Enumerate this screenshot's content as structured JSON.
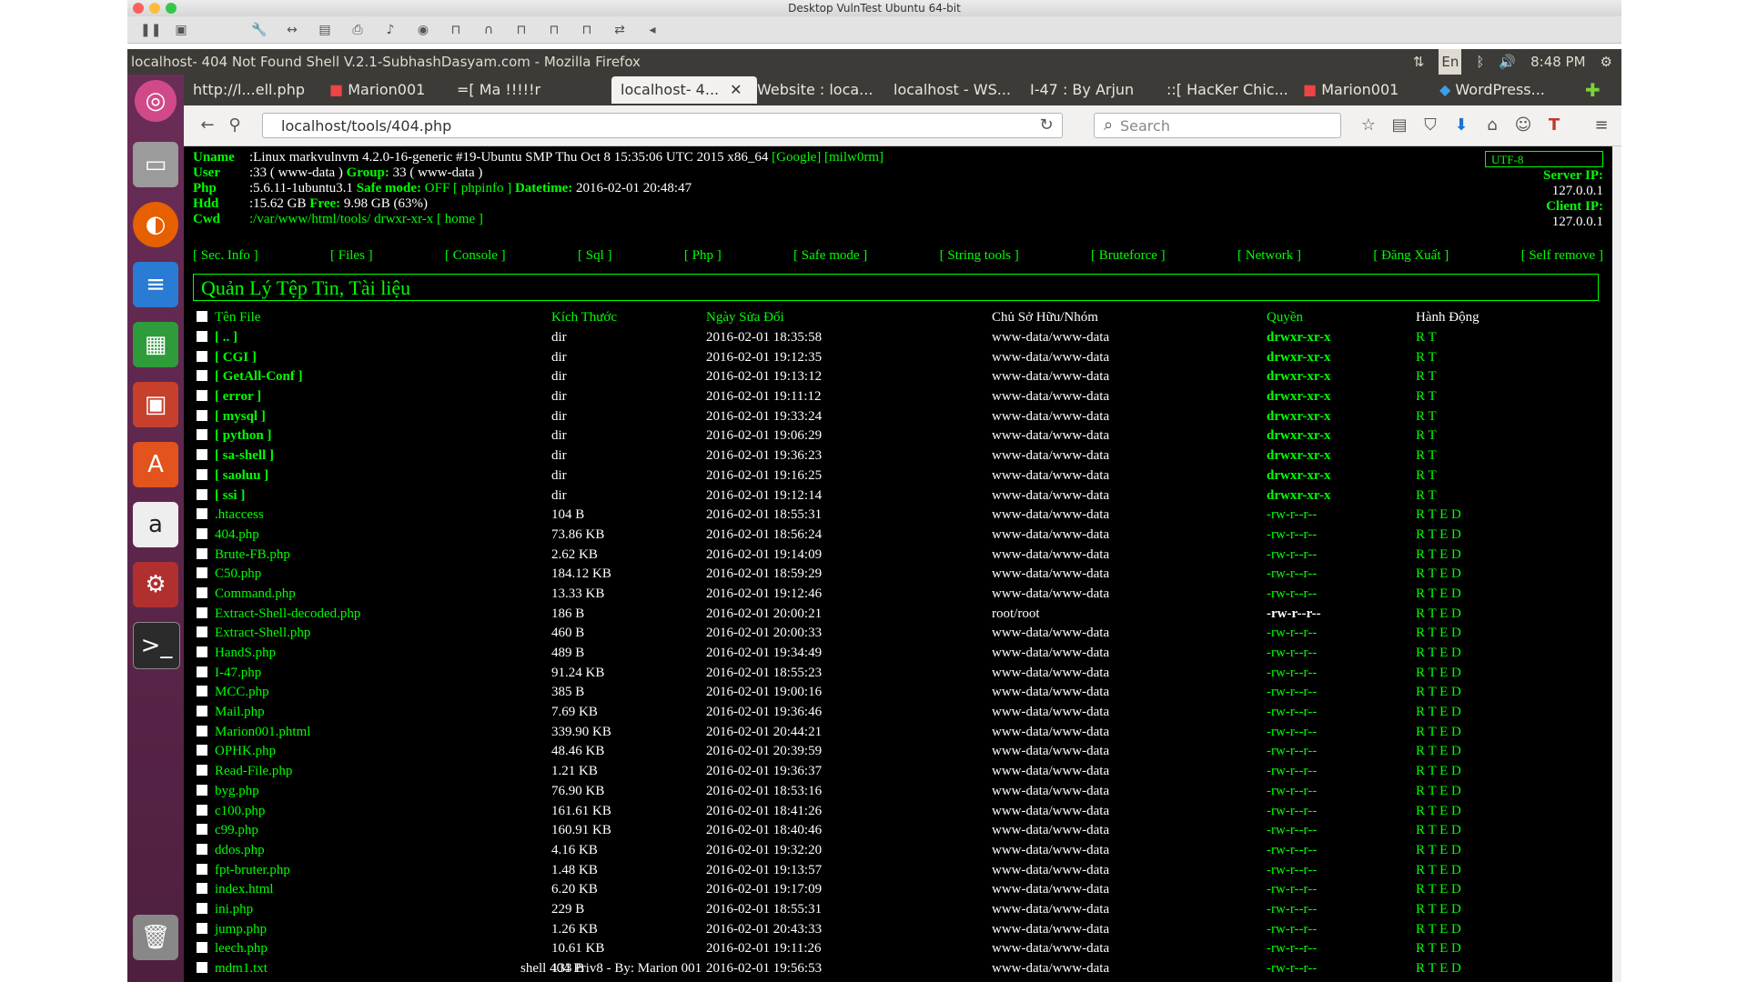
{
  "vm": {
    "title": "Desktop VulnTest Ubuntu 64-bit",
    "toolbar_icons": [
      "pause-icon",
      "snapshot-icon",
      "wrench-icon",
      "network-icon",
      "disk-icon",
      "printer-icon",
      "sound-icon",
      "camera-icon",
      "usb-icon",
      "headset-icon",
      "usb-icon",
      "usb-icon",
      "usb-icon",
      "share-icon",
      "collapse-icon"
    ]
  },
  "ubuntu": {
    "window_title": "localhost- 404 Not Found Shell V.2.1-SubhashDasyam.com - Mozilla Firefox",
    "keyboard": "En",
    "time": "8:48 PM"
  },
  "browser": {
    "tabs": [
      {
        "label": "http://l...ell.php"
      },
      {
        "label": "Marion001"
      },
      {
        "label": "=[ Ma !!!!!r"
      },
      {
        "label": "localhost- 4...",
        "active": true
      },
      {
        "label": "Website : loca..."
      },
      {
        "label": "localhost - WS..."
      },
      {
        "label": "I-47 : By Arjun"
      },
      {
        "label": "::[ HacKer Chic..."
      },
      {
        "label": "Marion001"
      },
      {
        "label": "WordPress..."
      }
    ],
    "url": "localhost/tools/404.php",
    "search_placeholder": "Search"
  },
  "shell": {
    "uname_label": "Uname",
    "uname_value": ":Linux markvulnvm 4.2.0-16-generic #19-Ubuntu SMP Thu Oct 8 15:35:06 UTC 2015 x86_64",
    "uname_links": "[Google] [milw0rm]",
    "user_label": "User",
    "user_value": ":33 ( www-data )",
    "group_label": "Group:",
    "group_value": "33 ( www-data )",
    "php_label": "Php",
    "php_value": ":5.6.11-1ubuntu3.1",
    "safe_label": "Safe mode:",
    "safe_value": "OFF [ phpinfo ]",
    "datetime_label": "Datetime:",
    "datetime_value": "2016-02-01 20:48:47",
    "hdd_label": "Hdd",
    "hdd_value": ":15.62 GB",
    "free_label": "Free:",
    "free_value": "9.98 GB (63%)",
    "cwd_label": "Cwd",
    "cwd_value": ":/var/www/html/tools/ drwxr-xr-x [ home ]",
    "encoding": "UTF-8",
    "server_ip_label": "Server IP:",
    "server_ip": "127.0.0.1",
    "client_ip_label": "Client IP:",
    "client_ip": "127.0.0.1",
    "menu": [
      "[ Sec. Info ]",
      "[ Files ]",
      "[ Console ]",
      "[ Sql ]",
      "[ Php ]",
      "[ Safe mode ]",
      "[ String tools ]",
      "[ Bruteforce ]",
      "[ Network ]",
      "[ Đăng Xuất ]",
      "[ Self remove ]"
    ],
    "section_title": "Quản Lý Tệp Tin, Tài liệu",
    "columns": [
      "Tên File",
      "Kích Thước",
      "Ngày Sửa Đổi",
      "Chủ Sở Hữu/Nhóm",
      "Quyền",
      "Hành Động"
    ],
    "rows": [
      {
        "name": "[ .. ]",
        "size": "dir",
        "date": "2016-02-01 18:35:58",
        "owner": "www-data/www-data",
        "perm": "drwxr-xr-x",
        "act": "R T",
        "dir": true
      },
      {
        "name": "[ CGI ]",
        "size": "dir",
        "date": "2016-02-01 19:12:35",
        "owner": "www-data/www-data",
        "perm": "drwxr-xr-x",
        "act": "R T",
        "dir": true
      },
      {
        "name": "[ GetAll-Conf ]",
        "size": "dir",
        "date": "2016-02-01 19:13:12",
        "owner": "www-data/www-data",
        "perm": "drwxr-xr-x",
        "act": "R T",
        "dir": true
      },
      {
        "name": "[ error ]",
        "size": "dir",
        "date": "2016-02-01 19:11:12",
        "owner": "www-data/www-data",
        "perm": "drwxr-xr-x",
        "act": "R T",
        "dir": true
      },
      {
        "name": "[ mysql ]",
        "size": "dir",
        "date": "2016-02-01 19:33:24",
        "owner": "www-data/www-data",
        "perm": "drwxr-xr-x",
        "act": "R T",
        "dir": true
      },
      {
        "name": "[ python ]",
        "size": "dir",
        "date": "2016-02-01 19:06:29",
        "owner": "www-data/www-data",
        "perm": "drwxr-xr-x",
        "act": "R T",
        "dir": true
      },
      {
        "name": "[ sa-shell ]",
        "size": "dir",
        "date": "2016-02-01 19:36:23",
        "owner": "www-data/www-data",
        "perm": "drwxr-xr-x",
        "act": "R T",
        "dir": true
      },
      {
        "name": "[ saoluu ]",
        "size": "dir",
        "date": "2016-02-01 19:16:25",
        "owner": "www-data/www-data",
        "perm": "drwxr-xr-x",
        "act": "R T",
        "dir": true
      },
      {
        "name": "[ ssi ]",
        "size": "dir",
        "date": "2016-02-01 19:12:14",
        "owner": "www-data/www-data",
        "perm": "drwxr-xr-x",
        "act": "R T",
        "dir": true
      },
      {
        "name": ".htaccess",
        "size": "104 B",
        "date": "2016-02-01 18:55:31",
        "owner": "www-data/www-data",
        "perm": "-rw-r--r--",
        "act": "R T E D"
      },
      {
        "name": "404.php",
        "size": "73.86 KB",
        "date": "2016-02-01 18:56:24",
        "owner": "www-data/www-data",
        "perm": "-rw-r--r--",
        "act": "R T E D"
      },
      {
        "name": "Brute-FB.php",
        "size": "2.62 KB",
        "date": "2016-02-01 19:14:09",
        "owner": "www-data/www-data",
        "perm": "-rw-r--r--",
        "act": "R T E D"
      },
      {
        "name": "C50.php",
        "size": "184.12 KB",
        "date": "2016-02-01 18:59:29",
        "owner": "www-data/www-data",
        "perm": "-rw-r--r--",
        "act": "R T E D"
      },
      {
        "name": "Command.php",
        "size": "13.33 KB",
        "date": "2016-02-01 19:12:46",
        "owner": "www-data/www-data",
        "perm": "-rw-r--r--",
        "act": "R T E D"
      },
      {
        "name": "Extract-Shell-decoded.php",
        "size": "186 B",
        "date": "2016-02-01 20:00:21",
        "owner": "root/root",
        "perm": "-rw-r--r--",
        "act": "R T E D",
        "root": true
      },
      {
        "name": "Extract-Shell.php",
        "size": "460 B",
        "date": "2016-02-01 20:00:33",
        "owner": "www-data/www-data",
        "perm": "-rw-r--r--",
        "act": "R T E D"
      },
      {
        "name": "HandS.php",
        "size": "489 B",
        "date": "2016-02-01 19:34:49",
        "owner": "www-data/www-data",
        "perm": "-rw-r--r--",
        "act": "R T E D"
      },
      {
        "name": "I-47.php",
        "size": "91.24 KB",
        "date": "2016-02-01 18:55:23",
        "owner": "www-data/www-data",
        "perm": "-rw-r--r--",
        "act": "R T E D"
      },
      {
        "name": "MCC.php",
        "size": "385 B",
        "date": "2016-02-01 19:00:16",
        "owner": "www-data/www-data",
        "perm": "-rw-r--r--",
        "act": "R T E D"
      },
      {
        "name": "Mail.php",
        "size": "7.69 KB",
        "date": "2016-02-01 19:36:46",
        "owner": "www-data/www-data",
        "perm": "-rw-r--r--",
        "act": "R T E D"
      },
      {
        "name": "Marion001.phtml",
        "size": "339.90 KB",
        "date": "2016-02-01 20:44:21",
        "owner": "www-data/www-data",
        "perm": "-rw-r--r--",
        "act": "R T E D"
      },
      {
        "name": "OPHK.php",
        "size": "48.46 KB",
        "date": "2016-02-01 20:39:59",
        "owner": "www-data/www-data",
        "perm": "-rw-r--r--",
        "act": "R T E D"
      },
      {
        "name": "Read-File.php",
        "size": "1.21 KB",
        "date": "2016-02-01 19:36:37",
        "owner": "www-data/www-data",
        "perm": "-rw-r--r--",
        "act": "R T E D"
      },
      {
        "name": "byg.php",
        "size": "76.90 KB",
        "date": "2016-02-01 18:53:16",
        "owner": "www-data/www-data",
        "perm": "-rw-r--r--",
        "act": "R T E D"
      },
      {
        "name": "c100.php",
        "size": "161.61 KB",
        "date": "2016-02-01 18:41:26",
        "owner": "www-data/www-data",
        "perm": "-rw-r--r--",
        "act": "R T E D"
      },
      {
        "name": "c99.php",
        "size": "160.91 KB",
        "date": "2016-02-01 18:40:46",
        "owner": "www-data/www-data",
        "perm": "-rw-r--r--",
        "act": "R T E D"
      },
      {
        "name": "ddos.php",
        "size": "4.16 KB",
        "date": "2016-02-01 19:32:20",
        "owner": "www-data/www-data",
        "perm": "-rw-r--r--",
        "act": "R T E D"
      },
      {
        "name": "fpt-bruter.php",
        "size": "1.48 KB",
        "date": "2016-02-01 19:13:57",
        "owner": "www-data/www-data",
        "perm": "-rw-r--r--",
        "act": "R T E D"
      },
      {
        "name": "index.html",
        "size": "6.20 KB",
        "date": "2016-02-01 19:17:09",
        "owner": "www-data/www-data",
        "perm": "-rw-r--r--",
        "act": "R T E D"
      },
      {
        "name": "ini.php",
        "size": "229 B",
        "date": "2016-02-01 18:55:31",
        "owner": "www-data/www-data",
        "perm": "-rw-r--r--",
        "act": "R T E D"
      },
      {
        "name": "jump.php",
        "size": "1.26 KB",
        "date": "2016-02-01 20:43:33",
        "owner": "www-data/www-data",
        "perm": "-rw-r--r--",
        "act": "R T E D"
      },
      {
        "name": "leech.php",
        "size": "10.61 KB",
        "date": "2016-02-01 19:11:26",
        "owner": "www-data/www-data",
        "perm": "-rw-r--r--",
        "act": "R T E D"
      },
      {
        "name": "mdm1.txt",
        "size": "133 B",
        "date": "2016-02-01 19:56:53",
        "owner": "www-data/www-data",
        "perm": "-rw-r--r--",
        "act": "R T E D"
      }
    ],
    "footer_note": "shell 404 Priv8 - By: Marion 001"
  },
  "colors": {
    "accent": "#00ff00",
    "background": "#000000"
  }
}
